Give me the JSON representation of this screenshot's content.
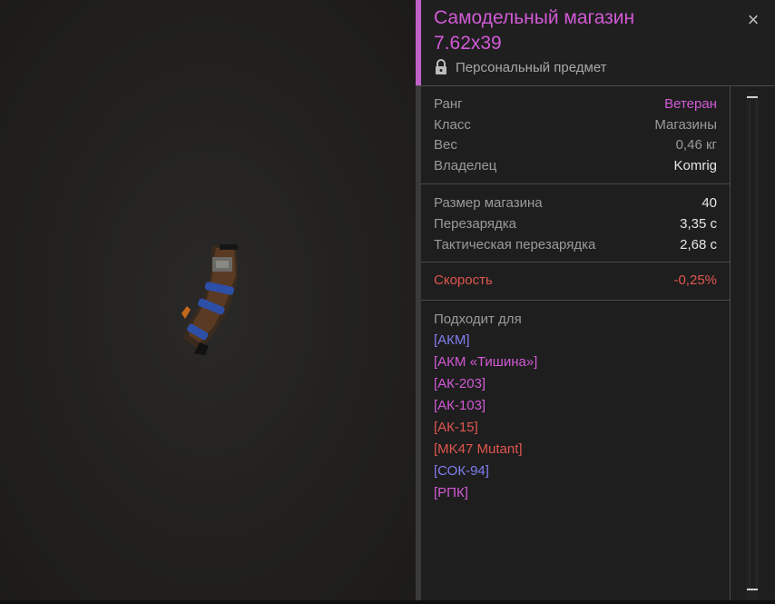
{
  "item": {
    "title": "Самодельный магазин\n7.62x39",
    "personal_label": "Персональный предмет",
    "close_symbol": "×"
  },
  "stats_basic": [
    {
      "label": "Ранг",
      "value": "Ветеран",
      "value_color": "#d25ad6"
    },
    {
      "label": "Класс",
      "value": "Магазины",
      "value_color": "#9a9a9a"
    },
    {
      "label": "Вес",
      "value": "0,46 кг",
      "value_color": "#9a9a9a"
    },
    {
      "label": "Владелец",
      "value": "Komrig",
      "value_color": "#e6e6e6"
    }
  ],
  "stats_mag": [
    {
      "label": "Размер магазина",
      "value": "40"
    },
    {
      "label": "Перезарядка",
      "value": "3,35 с"
    },
    {
      "label": "Тактическая перезарядка",
      "value": "2,68 с"
    }
  ],
  "stats_speed": {
    "label": "Скорость",
    "value": "-0,25%"
  },
  "compatible": {
    "title": "Подходит для",
    "items": [
      {
        "name": "[АКМ]",
        "color": "#7f7ff0"
      },
      {
        "name": "[АКМ «Тишина»]",
        "color": "#d25ad6"
      },
      {
        "name": "[АК-203]",
        "color": "#d25ad6"
      },
      {
        "name": "[АК-103]",
        "color": "#d25ad6"
      },
      {
        "name": "[АК-15]",
        "color": "#e0564f"
      },
      {
        "name": "[MK47 Mutant]",
        "color": "#e0564f"
      },
      {
        "name": "[СОК-94]",
        "color": "#7f7ff0"
      },
      {
        "name": "[РПК]",
        "color": "#d25ad6"
      }
    ]
  },
  "icons": {
    "lock": "lock-icon",
    "close": "close-icon"
  },
  "colors": {
    "accent": "#d25ad6",
    "negative": "#e0564f",
    "blue_link": "#7f7ff0"
  }
}
